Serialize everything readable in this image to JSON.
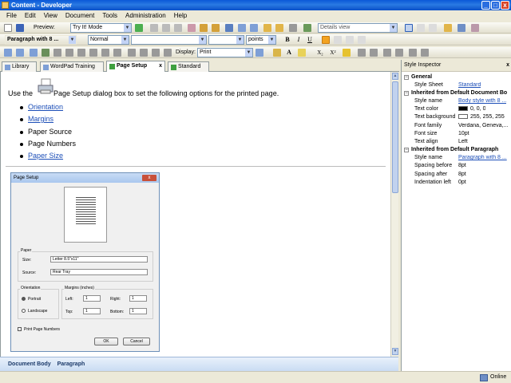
{
  "window": {
    "title": "Content - Developer",
    "minimize": "_",
    "maximize": "□",
    "close": "x"
  },
  "menu": [
    "File",
    "Edit",
    "View",
    "Document",
    "Tools",
    "Administration",
    "Help"
  ],
  "toolbar1": {
    "preview_label": "Preview:",
    "preview_mode": "Try It! Mode",
    "view_select": "Details view"
  },
  "toolbar2": {
    "paragraph_style": "Paragraph with 8 ...",
    "char_style": "Normal",
    "font": "",
    "size": "",
    "unit": "points",
    "bold": "B",
    "italic": "I",
    "underline": "U"
  },
  "toolbar3": {
    "display_label": "Display:",
    "display_value": "Print",
    "subscript": "X₂",
    "superscript": "X²"
  },
  "tabs": [
    {
      "label": "Library"
    },
    {
      "label": "WordPad Training"
    },
    {
      "label": "Page Setup"
    },
    {
      "label": "Standard"
    }
  ],
  "document": {
    "intro_before": "Use the",
    "intro_after": "Page Setup dialog box to set the following options for the printed page.",
    "items": [
      {
        "text": "Orientation",
        "link": true
      },
      {
        "text": "Margins",
        "link": true
      },
      {
        "text": "Paper Source",
        "link": false
      },
      {
        "text": "Page Numbers",
        "link": false
      },
      {
        "text": "Paper Size",
        "link": true
      }
    ]
  },
  "dialog": {
    "title": "Page Setup",
    "close": "x",
    "paper_group": "Paper",
    "size_label": "Size:",
    "size_value": "Letter 8.5\"x11\"",
    "source_label": "Source:",
    "source_value": "Rear Tray",
    "orientation_group": "Orientation",
    "portrait": "Portrait",
    "landscape": "Landscape",
    "margins_group": "Margins (inches)",
    "left_label": "Left:",
    "left_value": "1",
    "right_label": "Right:",
    "right_value": "1",
    "top_label": "Top:",
    "top_value": "1",
    "bottom_label": "Bottom:",
    "bottom_value": "1",
    "print_page_numbers": "Print Page Numbers",
    "ok": "OK",
    "cancel": "Cancel"
  },
  "breadcrumb": [
    "Document Body",
    "Paragraph"
  ],
  "status": {
    "connection": "Online"
  },
  "inspector": {
    "title": "Style Inspector",
    "groups": [
      {
        "title": "General",
        "rows": [
          {
            "key": "Style Sheet",
            "value": "Standard",
            "link": true
          }
        ]
      },
      {
        "title": "Inherited from Default Document Bo",
        "rows": [
          {
            "key": "Style name",
            "value": "Body style with 8 ...",
            "link": true
          },
          {
            "key": "Text color",
            "value": "0, 0, 0",
            "swatch": "#000000"
          },
          {
            "key": "Text background",
            "value": "255, 255, 255",
            "swatch": "#ffffff"
          },
          {
            "key": "Font family",
            "value": "Verdana, Geneva,..."
          },
          {
            "key": "Font size",
            "value": "10pt"
          },
          {
            "key": "Text align",
            "value": "Left"
          }
        ]
      },
      {
        "title": "Inherited from Default Paragraph",
        "rows": [
          {
            "key": "Style name",
            "value": "Paragraph with 8 ...",
            "link": true
          },
          {
            "key": "Spacing before",
            "value": "8pt"
          },
          {
            "key": "Spacing after",
            "value": "8pt"
          },
          {
            "key": "Indentation left",
            "value": "0pt"
          }
        ]
      }
    ]
  },
  "colors": {
    "titlebar": "#0a58d8",
    "link": "#1d4fb8",
    "accent": "#f3a320"
  }
}
